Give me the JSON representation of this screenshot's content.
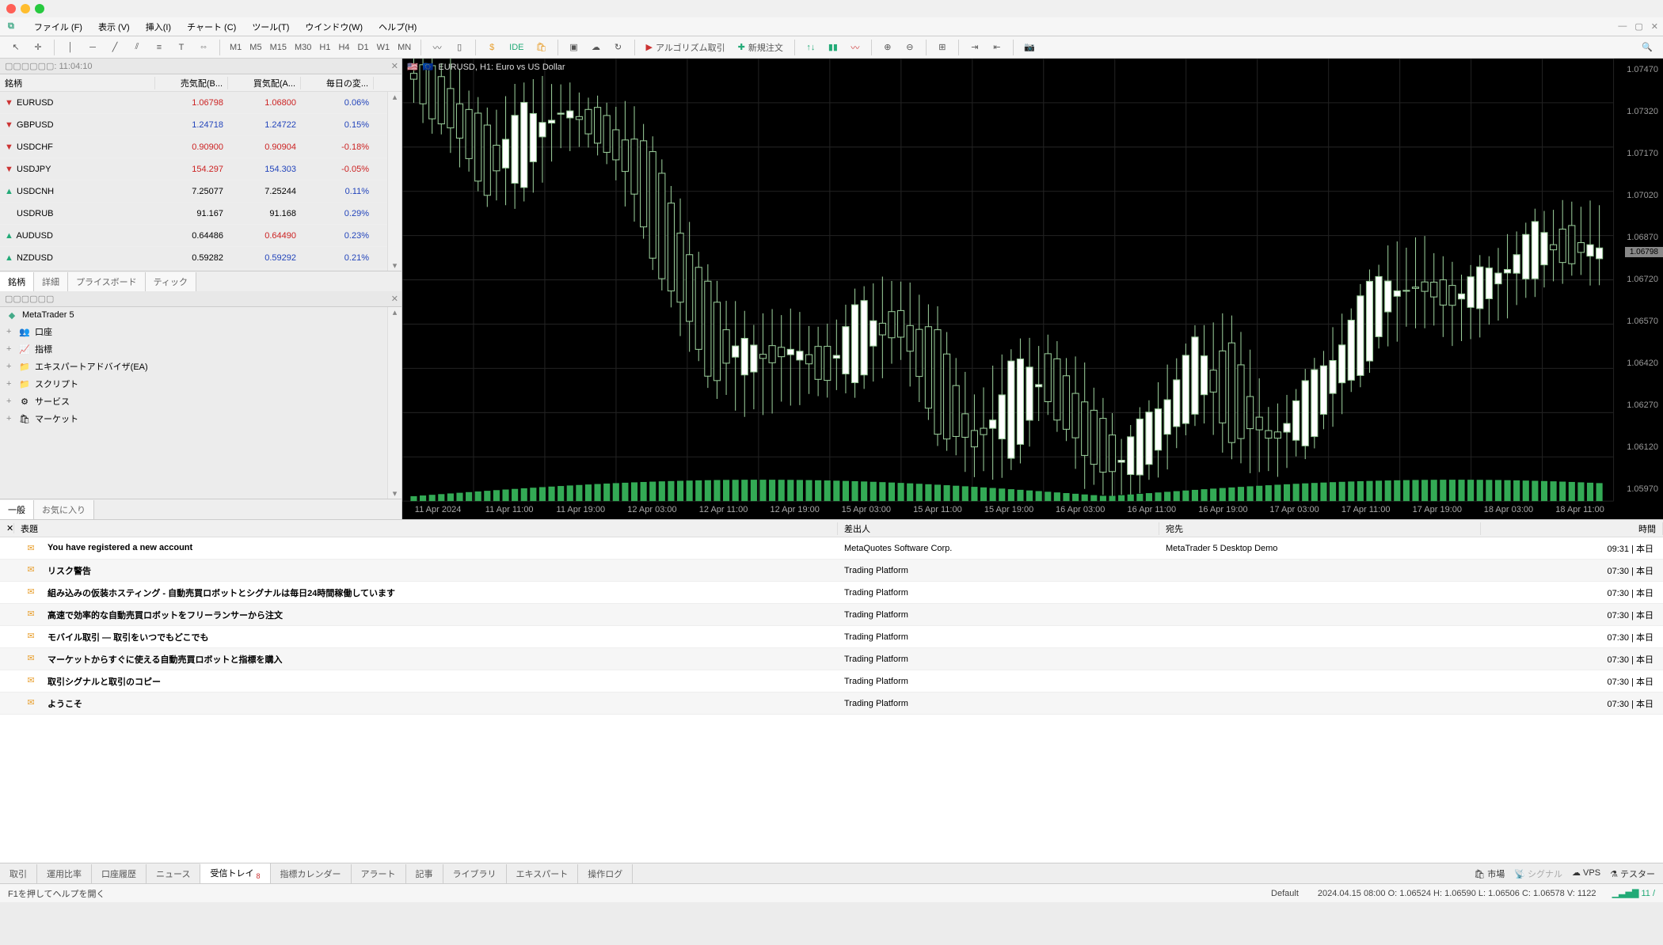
{
  "menubar": {
    "items": [
      "ファイル (F)",
      "表示 (V)",
      "挿入(I)",
      "チャート (C)",
      "ツール(T)",
      "ウインドウ(W)",
      "ヘルプ(H)"
    ]
  },
  "timeframes": [
    "M1",
    "M5",
    "M15",
    "M30",
    "H1",
    "H4",
    "D1",
    "W1",
    "MN"
  ],
  "toolbar": {
    "algo": "アルゴリズム取引",
    "neworder": "新規注文"
  },
  "marketwatch": {
    "title": "▢▢▢▢▢▢: 11:04:10",
    "cols": {
      "sym": "銘柄",
      "bid": "売気配(B...",
      "ask": "買気配(A...",
      "chg": "毎日の変..."
    },
    "rows": [
      {
        "s": "EURUSD",
        "b": "1.06798",
        "a": "1.06800",
        "c": "0.06%",
        "dir": "dn",
        "bidc": "red",
        "askc": "red",
        "chgc": "blue"
      },
      {
        "s": "GBPUSD",
        "b": "1.24718",
        "a": "1.24722",
        "c": "0.15%",
        "dir": "dn",
        "bidc": "blue",
        "askc": "blue",
        "chgc": "blue"
      },
      {
        "s": "USDCHF",
        "b": "0.90900",
        "a": "0.90904",
        "c": "-0.18%",
        "dir": "dn",
        "bidc": "red",
        "askc": "red",
        "chgc": "red"
      },
      {
        "s": "USDJPY",
        "b": "154.297",
        "a": "154.303",
        "c": "-0.05%",
        "dir": "dn",
        "bidc": "red",
        "askc": "blue",
        "chgc": "red"
      },
      {
        "s": "USDCNH",
        "b": "7.25077",
        "a": "7.25244",
        "c": "0.11%",
        "dir": "up",
        "bidc": "",
        "askc": "",
        "chgc": "blue"
      },
      {
        "s": "USDRUB",
        "b": "91.167",
        "a": "91.168",
        "c": "0.29%",
        "dir": "",
        "bidc": "",
        "askc": "",
        "chgc": "blue"
      },
      {
        "s": "AUDUSD",
        "b": "0.64486",
        "a": "0.64490",
        "c": "0.23%",
        "dir": "up",
        "bidc": "",
        "askc": "red",
        "chgc": "blue"
      },
      {
        "s": "NZDUSD",
        "b": "0.59282",
        "a": "0.59292",
        "c": "0.21%",
        "dir": "up",
        "bidc": "",
        "askc": "blue",
        "chgc": "blue"
      }
    ],
    "tabs": [
      "銘柄",
      "詳細",
      "プライスボード",
      "ティック"
    ]
  },
  "navigator": {
    "root": "MetaTrader 5",
    "items": [
      {
        "l": "口座",
        "ic": "👥"
      },
      {
        "l": "指標",
        "ic": "📈"
      },
      {
        "l": "エキスパートアドバイザ(EA)",
        "ic": "📁"
      },
      {
        "l": "スクリプト",
        "ic": "📁"
      },
      {
        "l": "サービス",
        "ic": "⚙"
      },
      {
        "l": "マーケット",
        "ic": "🛍"
      }
    ],
    "tabs": [
      "一般",
      "お気に入り"
    ]
  },
  "chart": {
    "title": "EURUSD, H1:  Euro vs US Dollar",
    "pricescale": [
      "1.07470",
      "1.07320",
      "1.07170",
      "1.07020",
      "1.06870",
      "1.06720",
      "1.06570",
      "1.06420",
      "1.06270",
      "1.06120",
      "1.05970"
    ],
    "pricetag": "1.06798",
    "timescale": [
      "11 Apr 2024",
      "11 Apr 11:00",
      "11 Apr 19:00",
      "12 Apr 03:00",
      "12 Apr 11:00",
      "12 Apr 19:00",
      "15 Apr 03:00",
      "15 Apr 11:00",
      "15 Apr 19:00",
      "16 Apr 03:00",
      "16 Apr 11:00",
      "16 Apr 19:00",
      "17 Apr 03:00",
      "17 Apr 11:00",
      "17 Apr 19:00",
      "18 Apr 03:00",
      "18 Apr 11:00"
    ]
  },
  "chart_data": {
    "type": "candlestick",
    "symbol": "EURUSD",
    "timeframe": "H1",
    "ylim": [
      1.0597,
      1.0747
    ],
    "ohlc_approx": [
      {
        "t": "11 Apr 00:00",
        "o": 1.0742,
        "h": 1.0748,
        "l": 1.0732,
        "c": 1.074
      },
      {
        "t": "11 Apr 04:00",
        "o": 1.074,
        "h": 1.0744,
        "l": 1.0718,
        "c": 1.072
      },
      {
        "t": "11 Apr 08:00",
        "o": 1.072,
        "h": 1.0726,
        "l": 1.07,
        "c": 1.0704
      },
      {
        "t": "11 Apr 12:00",
        "o": 1.0704,
        "h": 1.0738,
        "l": 1.07,
        "c": 1.0732
      },
      {
        "t": "11 Apr 16:00",
        "o": 1.0732,
        "h": 1.0736,
        "l": 1.072,
        "c": 1.0726
      },
      {
        "t": "11 Apr 20:00",
        "o": 1.0726,
        "h": 1.073,
        "l": 1.0718,
        "c": 1.0722
      },
      {
        "t": "12 Apr 00:00",
        "o": 1.0722,
        "h": 1.0728,
        "l": 1.0692,
        "c": 1.0696
      },
      {
        "t": "12 Apr 04:00",
        "o": 1.0696,
        "h": 1.07,
        "l": 1.066,
        "c": 1.0664
      },
      {
        "t": "12 Apr 08:00",
        "o": 1.0664,
        "h": 1.067,
        "l": 1.0636,
        "c": 1.064
      },
      {
        "t": "12 Apr 12:00",
        "o": 1.064,
        "h": 1.0656,
        "l": 1.0628,
        "c": 1.065
      },
      {
        "t": "12 Apr 16:00",
        "o": 1.065,
        "h": 1.066,
        "l": 1.0632,
        "c": 1.0646
      },
      {
        "t": "12 Apr 20:00",
        "o": 1.0646,
        "h": 1.0652,
        "l": 1.0636,
        "c": 1.064
      },
      {
        "t": "15 Apr 00:00",
        "o": 1.064,
        "h": 1.0668,
        "l": 1.0636,
        "c": 1.0664
      },
      {
        "t": "15 Apr 04:00",
        "o": 1.0664,
        "h": 1.067,
        "l": 1.0648,
        "c": 1.0652
      },
      {
        "t": "15 Apr 08:00",
        "o": 1.0652,
        "h": 1.066,
        "l": 1.062,
        "c": 1.0624
      },
      {
        "t": "15 Apr 12:00",
        "o": 1.0624,
        "h": 1.063,
        "l": 1.0608,
        "c": 1.0612
      },
      {
        "t": "15 Apr 16:00",
        "o": 1.0612,
        "h": 1.0648,
        "l": 1.0608,
        "c": 1.0644
      },
      {
        "t": "15 Apr 20:00",
        "o": 1.0644,
        "h": 1.065,
        "l": 1.063,
        "c": 1.0634
      },
      {
        "t": "16 Apr 00:00",
        "o": 1.0634,
        "h": 1.064,
        "l": 1.0604,
        "c": 1.0608
      },
      {
        "t": "16 Apr 04:00",
        "o": 1.0608,
        "h": 1.0616,
        "l": 1.06,
        "c": 1.0612
      },
      {
        "t": "16 Apr 08:00",
        "o": 1.0612,
        "h": 1.0636,
        "l": 1.0608,
        "c": 1.0632
      },
      {
        "t": "16 Apr 12:00",
        "o": 1.0632,
        "h": 1.0654,
        "l": 1.0628,
        "c": 1.065
      },
      {
        "t": "16 Apr 16:00",
        "o": 1.065,
        "h": 1.0658,
        "l": 1.0612,
        "c": 1.0616
      },
      {
        "t": "16 Apr 20:00",
        "o": 1.0616,
        "h": 1.0624,
        "l": 1.0608,
        "c": 1.062
      },
      {
        "t": "17 Apr 00:00",
        "o": 1.062,
        "h": 1.064,
        "l": 1.0616,
        "c": 1.0636
      },
      {
        "t": "17 Apr 04:00",
        "o": 1.0636,
        "h": 1.066,
        "l": 1.0632,
        "c": 1.0656
      },
      {
        "t": "17 Apr 08:00",
        "o": 1.0656,
        "h": 1.068,
        "l": 1.0652,
        "c": 1.0676
      },
      {
        "t": "17 Apr 12:00",
        "o": 1.0676,
        "h": 1.0684,
        "l": 1.066,
        "c": 1.0664
      },
      {
        "t": "17 Apr 16:00",
        "o": 1.0664,
        "h": 1.0672,
        "l": 1.0652,
        "c": 1.0668
      },
      {
        "t": "17 Apr 20:00",
        "o": 1.0668,
        "h": 1.068,
        "l": 1.066,
        "c": 1.0676
      },
      {
        "t": "18 Apr 00:00",
        "o": 1.0676,
        "h": 1.0692,
        "l": 1.067,
        "c": 1.0688
      },
      {
        "t": "18 Apr 04:00",
        "o": 1.0688,
        "h": 1.0696,
        "l": 1.0676,
        "c": 1.068
      },
      {
        "t": "18 Apr 08:00",
        "o": 1.068,
        "h": 1.0694,
        "l": 1.0672,
        "c": 1.068
      }
    ]
  },
  "messages": {
    "cols": {
      "subj": "表題",
      "from": "差出人",
      "to": "宛先",
      "time": "時間"
    },
    "rows": [
      {
        "s": "You have registered a new account",
        "f": "MetaQuotes Software Corp.",
        "t": "MetaTrader 5 Desktop Demo",
        "tm": "09:31 | 本日"
      },
      {
        "s": "リスク警告",
        "f": "Trading Platform",
        "t": "",
        "tm": "07:30 | 本日"
      },
      {
        "s": "組み込みの仮装ホスティング - 自動売買ロボットとシグナルは毎日24時間稼働しています",
        "f": "Trading Platform",
        "t": "",
        "tm": "07:30 | 本日"
      },
      {
        "s": "高速で効率的な自動売買ロボットをフリーランサーから注文",
        "f": "Trading Platform",
        "t": "",
        "tm": "07:30 | 本日"
      },
      {
        "s": "モバイル取引 — 取引をいつでもどこでも",
        "f": "Trading Platform",
        "t": "",
        "tm": "07:30 | 本日"
      },
      {
        "s": "マーケットからすぐに使える自動売買ロボットと指標を購入",
        "f": "Trading Platform",
        "t": "",
        "tm": "07:30 | 本日"
      },
      {
        "s": "取引シグナルと取引のコピー",
        "f": "Trading Platform",
        "t": "",
        "tm": "07:30 | 本日"
      },
      {
        "s": "ようこそ",
        "f": "Trading Platform",
        "t": "",
        "tm": "07:30 | 本日"
      }
    ]
  },
  "bottomtabs": {
    "left": [
      "取引",
      "運用比率",
      "口座履歴",
      "ニュース"
    ],
    "active": "受信トレイ",
    "badge": "8",
    "right": [
      "指標カレンダー",
      "アラート",
      "記事",
      "ライブラリ",
      "エキスパート",
      "操作ログ"
    ],
    "far": [
      "市場",
      "シグナル",
      "VPS",
      "テスター"
    ]
  },
  "status": {
    "help": "F1を押してヘルプを開く",
    "profile": "Default",
    "ohlc": "2024.04.15 08:00   O: 1.06524   H: 1.06590   L: 1.06506   C: 1.06578   V: 1122",
    "conn": "11 /"
  }
}
